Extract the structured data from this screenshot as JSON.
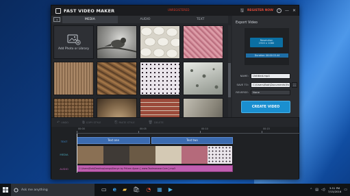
{
  "app": {
    "title": "FAST VIDEO MAKER",
    "unregistered": "UNREGISTERED",
    "register_label": "REGISTER NOW",
    "help_symbol": "?",
    "save_symbol": "🖫",
    "minimize_symbol": "—",
    "close_symbol": "✕"
  },
  "tabs": {
    "back_symbol": "◂",
    "items": [
      {
        "label": "MEDIA",
        "active": true
      },
      {
        "label": "AUDIO",
        "active": false
      },
      {
        "label": "TEXT",
        "active": false
      }
    ]
  },
  "media": {
    "add_label": "Add Photo or Library",
    "thumbnails": [
      "bird on branch",
      "white eggs",
      "pink texture",
      "knitting",
      "clay figure",
      "dotted fabric",
      "snow stones",
      "mouse ball",
      "pebbles",
      "pebbles crop",
      "bricks",
      "close texture"
    ]
  },
  "export": {
    "title": "Export Video",
    "resolution_label": "Resolution",
    "resolution_value": "1920 x 1080",
    "duration_text": "Duration: 00:00:15.44",
    "name_label": "NAME:",
    "name_value": "Untitled.mp4",
    "save_to_label": "SAVE TO:",
    "save_to_value": "C:\\Users\\Bob\\Documents\\Fa",
    "browse_symbol": "…",
    "reverse_label": "REVERSE:",
    "reverse_value": "None",
    "create_label": "CREATE VIDEO"
  },
  "toolbar": {
    "items": [
      {
        "label": "UNDO",
        "icon": "undo-icon",
        "glyph": "↶"
      },
      {
        "label": "COPY STYLE",
        "icon": "copy-icon",
        "glyph": "⧉"
      },
      {
        "label": "PASTE STYLE",
        "icon": "paste-icon",
        "glyph": "⎘"
      },
      {
        "label": "DELETE",
        "icon": "trash-icon",
        "glyph": "🗑"
      }
    ]
  },
  "timeline": {
    "ruler": [
      "00:00",
      "00:05",
      "00:10",
      "00:15"
    ],
    "track_labels": {
      "text": "TEXT",
      "media": "MEDIA",
      "audio": "AUDIO"
    },
    "text_clips": [
      "Text one",
      "Text two"
    ],
    "audio_clip": "C:\\Users\\Bob\\Desktop\\songs\\Kanye by Pritam Ayaan [ www.Taalmanase.Com ].mp3"
  },
  "taskbar": {
    "search_placeholder": "Ask me anything",
    "time": "3:51 PM",
    "date": "7/15/2016",
    "app_glyphs": [
      "▭",
      "e",
      "▰",
      "🛍",
      "◔",
      "▦",
      "▶"
    ]
  },
  "colors": {
    "accent": "#1a8fd0",
    "text_clip": "#3b6bb0",
    "audio_clip": "#c05fb1",
    "unregistered": "#d23a2a"
  }
}
